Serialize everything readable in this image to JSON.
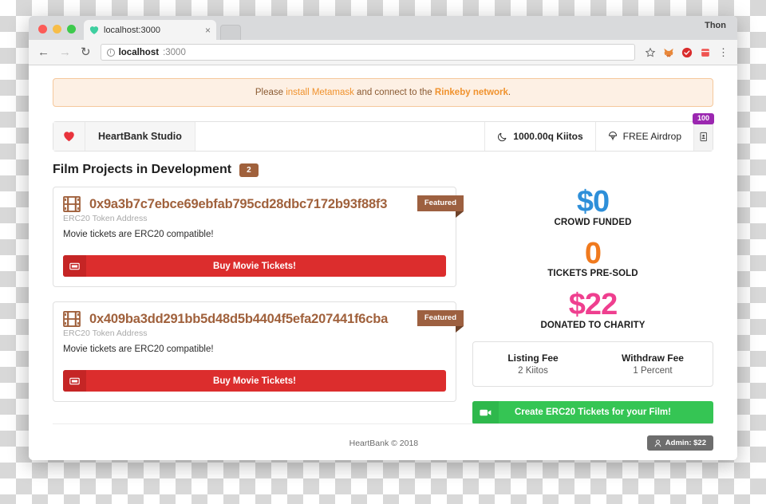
{
  "browser": {
    "profile_name": "Thon",
    "tab": {
      "title": "localhost:3000",
      "close_label": "×"
    },
    "omnibox": {
      "host": "localhost",
      "port": ":3000",
      "info_glyph": "i"
    },
    "nav": {
      "back": "←",
      "forward": "→",
      "reload": "↻",
      "menu": "⋮"
    }
  },
  "alert": {
    "prefix": "Please ",
    "link1": "install Metamask",
    "middle": " and connect to the ",
    "link2": "Rinkeby network",
    "suffix": "."
  },
  "navbar": {
    "brand": "HeartBank Studio",
    "kiitos": "1000.00q Kiitos",
    "airdrop": "FREE Airdrop",
    "airdrop_badge": "100"
  },
  "section": {
    "title": "Film Projects in Development",
    "count": "2"
  },
  "projects": [
    {
      "address": "0x9a3b7c7ebce69ebfab795cd28dbc7172b93f88f3",
      "subtitle": "ERC20 Token Address",
      "description": "Movie tickets are ERC20 compatible!",
      "ribbon": "Featured",
      "button": "Buy Movie Tickets!"
    },
    {
      "address": "0x409ba3dd291bb5d48d5b4404f5efa207441f6cba",
      "subtitle": "ERC20 Token Address",
      "description": "Movie tickets are ERC20 compatible!",
      "ribbon": "Featured",
      "button": "Buy Movie Tickets!"
    }
  ],
  "stats": [
    {
      "value": "$0",
      "label": "CROWD FUNDED",
      "color": "#2e8fd9"
    },
    {
      "value": "0",
      "label": "TICKETS PRE-SOLD",
      "color": "#f07a1e"
    },
    {
      "value": "$22",
      "label": "DONATED TO CHARITY",
      "color": "#ef3f8f"
    }
  ],
  "fees": [
    {
      "title": "Listing Fee",
      "value": "2 Kiitos"
    },
    {
      "title": "Withdraw Fee",
      "value": "1 Percent"
    }
  ],
  "create_button": {
    "label": "Create ERC20 Tickets for your Film!"
  },
  "footer": {
    "copyright": "HeartBank © 2018",
    "admin_badge": "Admin: $22"
  },
  "colors": {
    "brand_red": "#dc2d2d",
    "accent_brown": "#a0613c",
    "green": "#35c554",
    "purple_badge": "#9b27b0"
  }
}
